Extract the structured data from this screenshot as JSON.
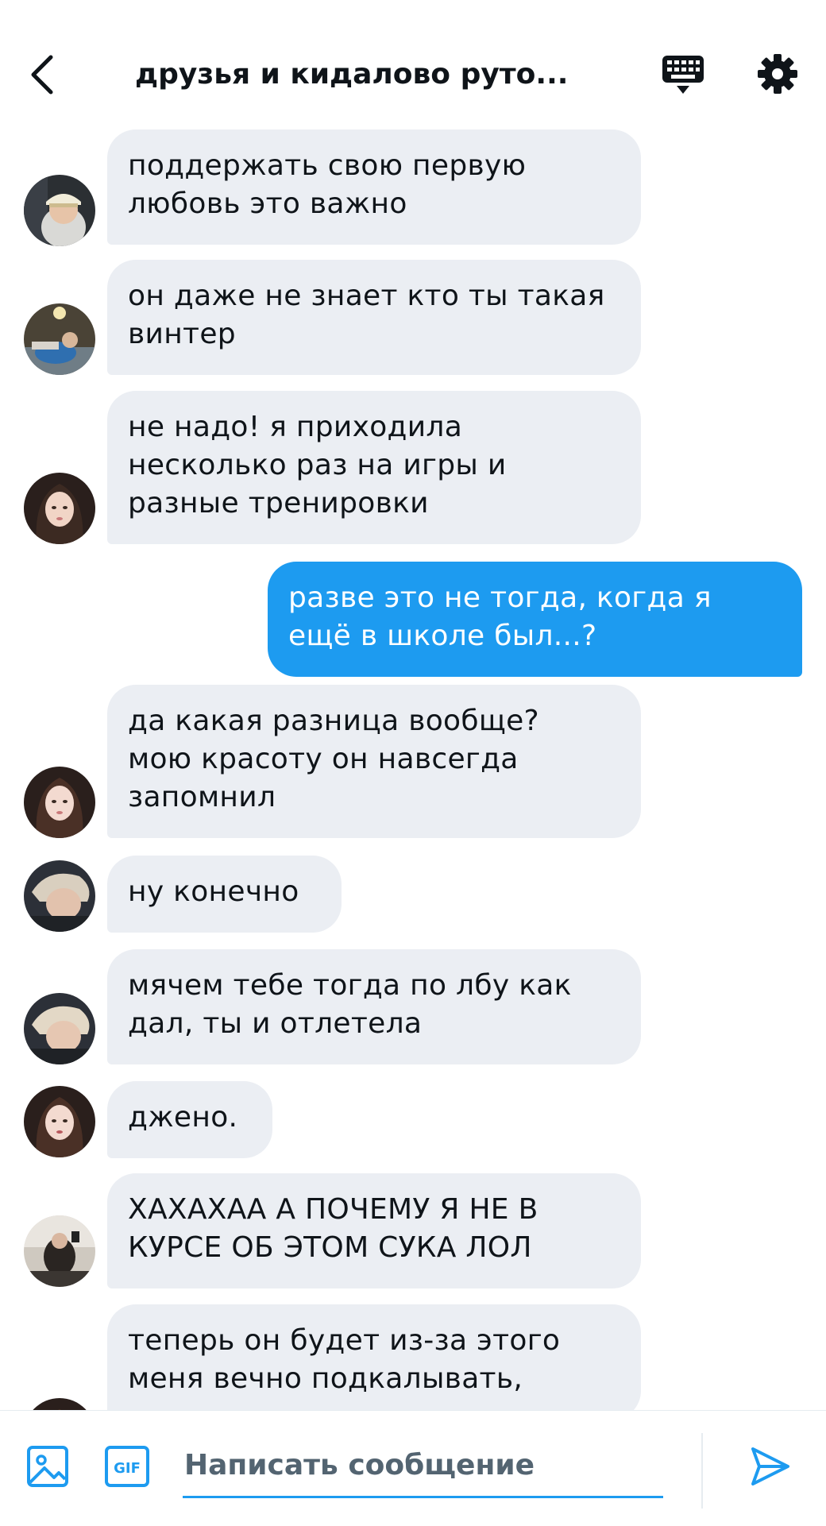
{
  "header": {
    "title": "друзья и кидалово руто...",
    "back_icon": "chevron-left-icon",
    "keyboard_icon": "keyboard-icon",
    "settings_icon": "gear-icon"
  },
  "messages": [
    {
      "direction": "in",
      "avatar": "avatar-user-cap",
      "text": "поддержать свою первую\nлюбовь это важно"
    },
    {
      "direction": "in",
      "avatar": "avatar-user-dark",
      "text": "он даже не знает кто ты такая\nвинтер"
    },
    {
      "direction": "in",
      "avatar": "avatar-user-girl",
      "text": "не надо! я приходила\nнесколько раз на игры и\nразные тренировки"
    },
    {
      "direction": "out",
      "text": "разве это не тогда, когда я\nещё в школе был...?"
    },
    {
      "direction": "in",
      "avatar": "avatar-user-girl",
      "text": "да какая разница вообще?\nмою красоту он навсегда\nзапомнил"
    },
    {
      "direction": "in",
      "avatar": "avatar-user-blond",
      "text": "ну конечно"
    },
    {
      "direction": "in",
      "avatar": "avatar-user-blond",
      "text": "мячем тебе тогда по лбу как\nдал, ты и отлетела"
    },
    {
      "direction": "in",
      "avatar": "avatar-user-girl",
      "text": "джено."
    },
    {
      "direction": "in",
      "avatar": "avatar-user-mirror",
      "text": "ХАХАХАА А ПОЧЕМУ Я НЕ В\nКУРСЕ ОБ ЭТОМ СУКА ЛОЛ"
    },
    {
      "direction": "in",
      "avatar": "avatar-user-girl",
      "text": "теперь он будет из-за этого\nменя вечно подкалывать,"
    }
  ],
  "composer": {
    "placeholder": "Написать сообщение",
    "gif_label": "GIF",
    "image_icon": "image-icon",
    "send_icon": "send-icon"
  },
  "colors": {
    "accent": "#1d9bf0",
    "incoming_bubble": "#ebeef3",
    "text": "#0f1419",
    "muted": "#536471"
  }
}
